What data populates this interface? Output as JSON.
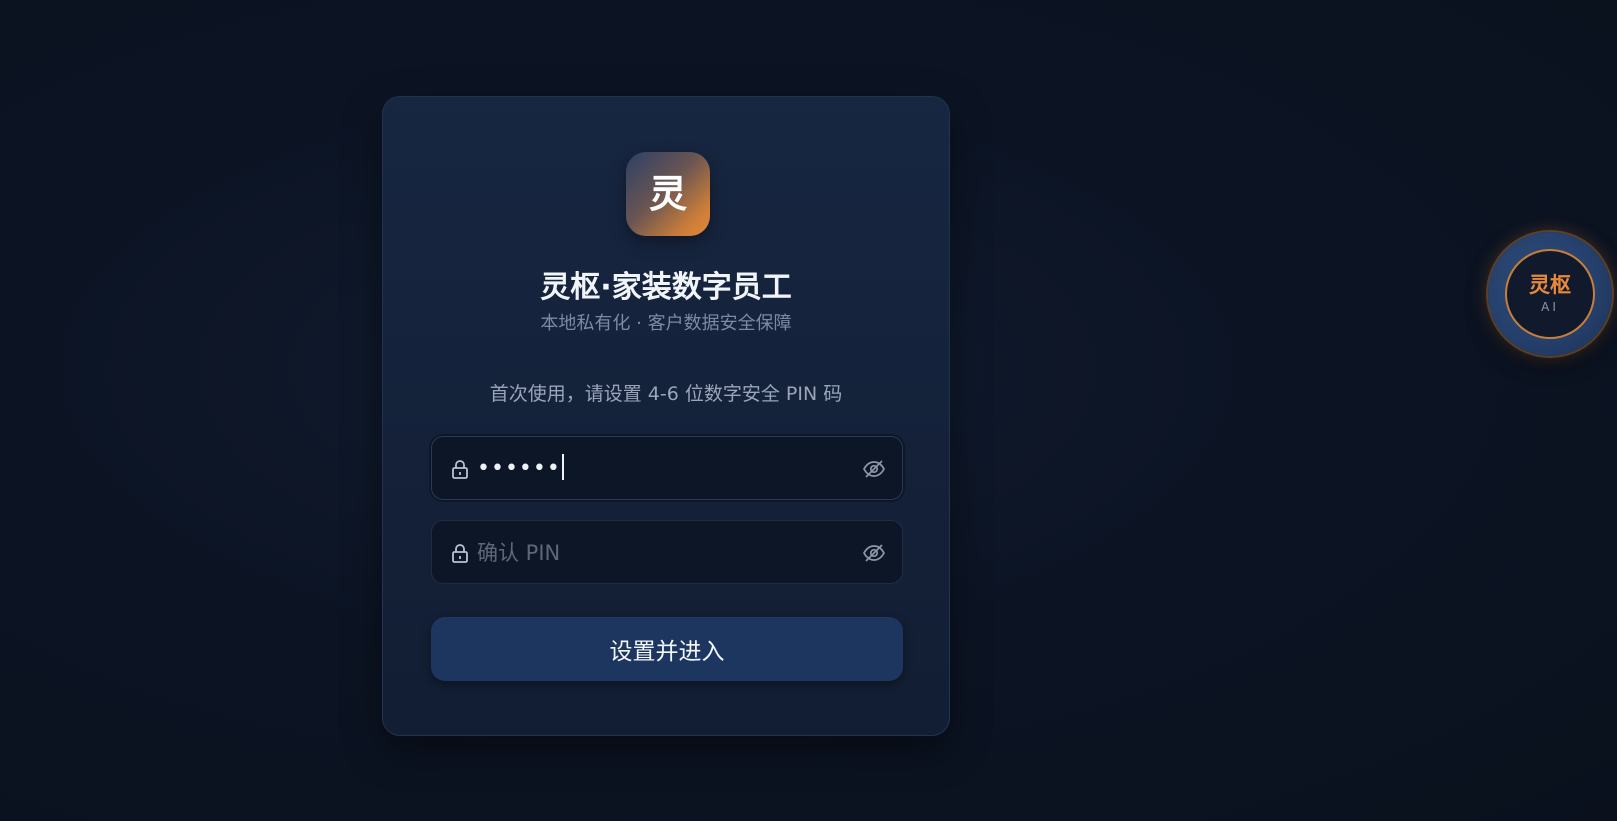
{
  "app": {
    "logo_char": "灵",
    "title": "灵枢·家装数字员工",
    "subtitle": "本地私有化 · 客户数据安全保障"
  },
  "form": {
    "hint": "首次使用，请设置 4-6 位数字安全 PIN 码",
    "pin_field": {
      "value": "••••••",
      "icon": "lock-icon",
      "toggle_icon": "eye-off-icon"
    },
    "confirm_field": {
      "placeholder": "确认 PIN",
      "value": "",
      "icon": "lock-icon",
      "toggle_icon": "eye-off-icon"
    },
    "submit_label": "设置并进入"
  },
  "assistant": {
    "title": "灵枢",
    "sub": "AI"
  },
  "colors": {
    "accent": "#e8883a",
    "button": "#1d3660",
    "card": "#152339",
    "background": "#0b1322"
  }
}
